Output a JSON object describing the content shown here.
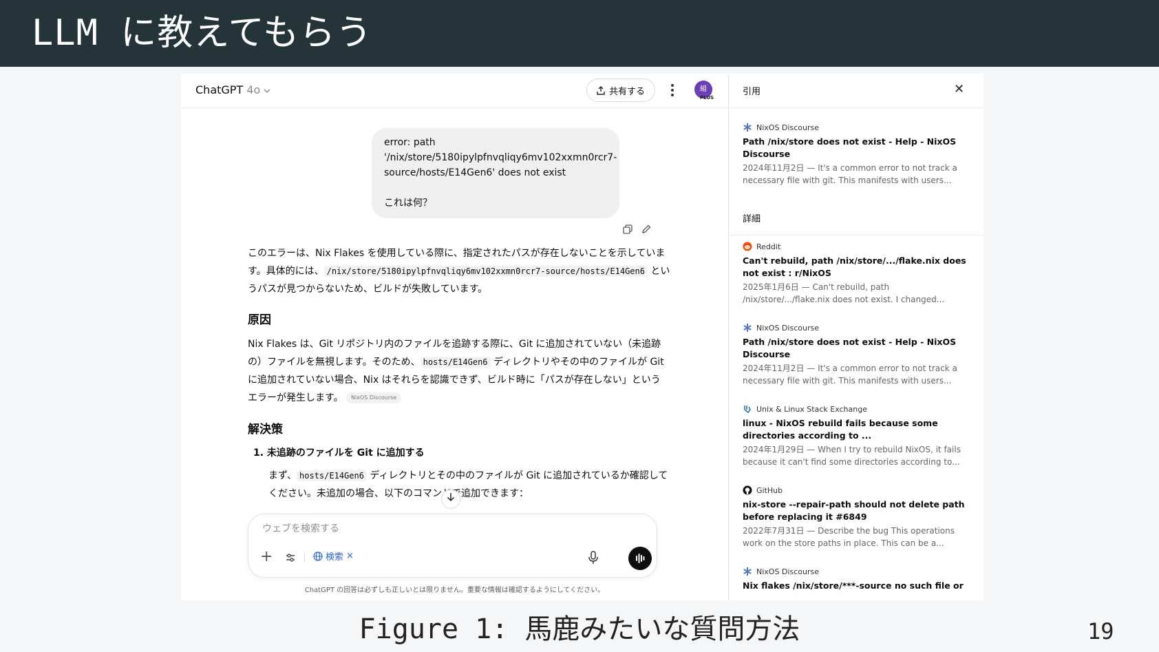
{
  "slide": {
    "title": "LLM に教えてもらう",
    "caption": "Figure 1: 馬鹿みたいな質問方法",
    "page_number": "19"
  },
  "chat": {
    "model": "ChatGPT",
    "model_version": "4o",
    "share_label": "共有する",
    "avatar_text": "組",
    "plan_badge": "PLUS",
    "user_message": {
      "line1": "error: path",
      "line2": "'/nix/store/5180ipylpfnvqliqy6mv102xxmn0rcr7-",
      "line3": "source/hosts/E14Gen6' does not exist",
      "question": "これは何？"
    },
    "answer": {
      "intro_a": "このエラーは、Nix Flakes を使用している際に、指定されたパスが存在しないことを示しています。具体的には、",
      "intro_code": "/nix/store/5180ipylpfnvqliqy6mv102xxmn0rcr7-source/hosts/E14Gen6",
      "intro_b": " というパスが見つからないため、ビルドが失敗しています。",
      "cause_heading": "原因",
      "cause_a": "Nix Flakes は、Git リポジトリ内のファイルを追跡する際に、Git に追加されていない（未追跡の）ファイルを無視します。そのため、",
      "cause_code": "hosts/E14Gen6",
      "cause_b": " ディレクトリやその中のファイルが Git に追加されていない場合、Nix はそれらを認識できず、ビルド時に「パスが存在しない」というエラーが発生します。",
      "cause_chip": "NixOS Discourse",
      "solution_heading": "解決策",
      "step1_title": "1.  未追跡のファイルを Git に追加する",
      "step1_a": "まず、",
      "step1_code": "hosts/E14Gen6",
      "step1_b": " ディレクトリとその中のファイルが Git に追加されているか確認してください。未追加の場合、以下のコマンドで追加できます："
    },
    "composer": {
      "placeholder": "ウェブを検索する",
      "search_chip": "検索"
    },
    "disclaimer": "ChatGPT の回答は必ずしも正しいとは限りません。重要な情報は確認するようにしてください。"
  },
  "citations": {
    "header": "引用",
    "detail_label": "詳細",
    "items": [
      {
        "source": "NixOS Discourse",
        "icon": "nixos-icon",
        "title": "Path /nix/store does not exist - Help - NixOS Discourse",
        "snippet": "2024年11月2日 — It's a common error to not track a necessary file with git. This manifests with users..."
      },
      {
        "source": "Reddit",
        "icon": "reddit-icon",
        "title": "Can't rebuild, path /nix/store/.../flake.nix does not exist : r/NixOS",
        "snippet": "2025年1月6日 — Can't rebuild, path /nix/store/.../flake.nix does not exist. I changed..."
      },
      {
        "source": "NixOS Discourse",
        "icon": "nixos-icon",
        "title": "Path /nix/store does not exist - Help - NixOS Discourse",
        "snippet": "2024年11月2日 — It's a common error to not track a necessary file with git. This manifests with users..."
      },
      {
        "source": "Unix & Linux Stack Exchange",
        "icon": "stackexchange-icon",
        "title": "linux - NixOS rebuild fails because some directories according to ...",
        "snippet": "2024年1月29日 — When I try to rebuild NixOS, it fails because it can't find some directories according to..."
      },
      {
        "source": "GitHub",
        "icon": "github-icon",
        "title": "nix-store --repair-path should not delete path before replacing it #6849",
        "snippet": "2022年7月31日 — Describe the bug This operations work on the store paths in place. This can be a..."
      },
      {
        "source": "NixOS Discourse",
        "icon": "nixos-icon",
        "title": "Nix flakes /nix/store/***-source no such file or",
        "snippet": ""
      }
    ]
  },
  "colors": {
    "header_bg": "#253438",
    "accent_link": "#2964d9",
    "avatar": "#6b3fb5"
  }
}
